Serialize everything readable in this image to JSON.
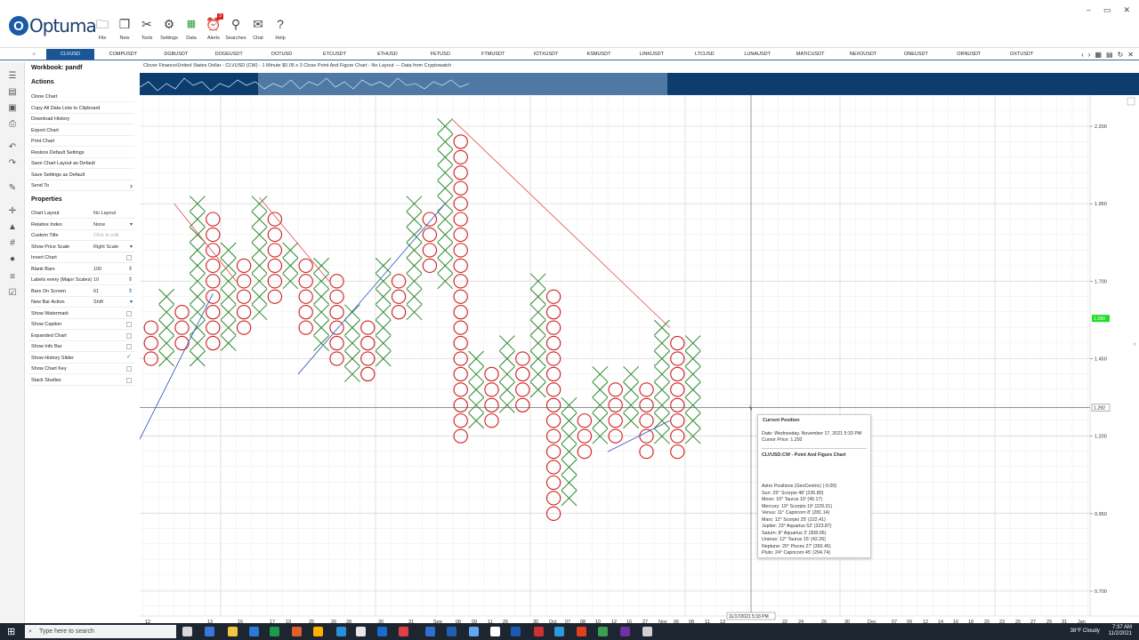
{
  "ribbon": {
    "logo_text": "Optuma",
    "buttons": [
      {
        "label": "File",
        "icon": "folder-icon"
      },
      {
        "label": "New",
        "icon": "new-document-icon"
      },
      {
        "label": "Tools",
        "icon": "tools-icon"
      },
      {
        "label": "Settings",
        "icon": "gear-icon"
      },
      {
        "label": "Data",
        "icon": "data-icon"
      },
      {
        "label": "Alerts",
        "icon": "alarm-clock-icon",
        "badge": "3"
      },
      {
        "label": "Searches",
        "icon": "search-icon"
      },
      {
        "label": "Chat",
        "icon": "chat-icon"
      },
      {
        "label": "Help",
        "icon": "help-icon"
      }
    ]
  },
  "tabs": [
    "CLVUSD",
    "COMPUSDT",
    "DGBUSDT",
    "DOGEUSDT",
    "DOTUSD",
    "ETCUSDT",
    "ETHUSD",
    "FETUSD",
    "FTMUSDT",
    "IOTXUSDT",
    "KSMUSDT",
    "LINKUSDT",
    "LTCUSD",
    "LUNAUSDT",
    "MATICUSDT",
    "NEXOUSDT",
    "ONEUSDT",
    "ORNUSDT",
    "OXTUSDT"
  ],
  "active_tab": "CLVUSD",
  "panel": {
    "workbook": "Workbook: pandf",
    "actions_heading": "Actions",
    "actions": [
      "Clone Chart",
      "Copy All Data Lists to Clipboard",
      "Download History",
      "Export Chart",
      "Print Chart",
      "Restore Default Settings",
      "Save Chart Layout as Default",
      "Save Settings as Default",
      "Send To"
    ],
    "properties_heading": "Properties",
    "properties": [
      {
        "label": "Chart Layout",
        "value": "No Layout",
        "kind": "text"
      },
      {
        "label": "Relative Index",
        "value": "None",
        "kind": "select"
      },
      {
        "label": "Custom Title",
        "value": "Click to edit",
        "kind": "muted"
      },
      {
        "label": "Show Price Scale",
        "value": "Right Scale",
        "kind": "select"
      },
      {
        "label": "Invert Chart",
        "value": "",
        "kind": "check",
        "checked": false
      },
      {
        "label": "Blank Bars",
        "value": "100",
        "kind": "spin"
      },
      {
        "label": "Labels every (Major Scales)",
        "value": "10",
        "kind": "spin"
      },
      {
        "label": "Bars On Screen",
        "value": "61",
        "kind": "spin"
      },
      {
        "label": "New Bar Action",
        "value": "Shift",
        "kind": "select"
      },
      {
        "label": "Show Watermark",
        "value": "",
        "kind": "check",
        "checked": false
      },
      {
        "label": "Show Caption",
        "value": "",
        "kind": "check",
        "checked": false
      },
      {
        "label": "Expanded Chart",
        "value": "",
        "kind": "check",
        "checked": false
      },
      {
        "label": "Show Info Bar",
        "value": "",
        "kind": "check",
        "checked": false
      },
      {
        "label": "Show History Slider",
        "value": "",
        "kind": "check",
        "checked": true
      },
      {
        "label": "Show Chart Key",
        "value": "",
        "kind": "check",
        "checked": false
      },
      {
        "label": "Stack Studies",
        "value": "",
        "kind": "check",
        "checked": false
      }
    ]
  },
  "chart_title": "Clover Finance/United States Dollar - CLVUSD (CW) - 1 Minute $0.05 x 3 Close Point And Figure Chart - No Layout --- Data from Cryptowatch",
  "chart_data": {
    "type": "point_and_figure",
    "box_size": 0.05,
    "reversal": 3,
    "y_ticks": [
      "2.200",
      "1.950",
      "1.700",
      "1.450",
      "1.200",
      "0.950",
      "0.700"
    ],
    "last_price": "1.580",
    "cursor_price": "1.292",
    "x_labels": [
      "12",
      "13",
      "16",
      "17",
      "19",
      "25",
      "26",
      "28",
      "30",
      "31",
      "Sep",
      "08",
      "09",
      "11",
      "26",
      "30",
      "Oct",
      "07",
      "08",
      "10",
      "12",
      "16",
      "27",
      "Nov",
      "06",
      "08",
      "11",
      "13",
      "22",
      "24",
      "26",
      "30",
      "Dec",
      "07",
      "09",
      "12",
      "14",
      "16",
      "18",
      "20",
      "23",
      "25",
      "27",
      "29",
      "31",
      "Jan"
    ],
    "cursor_date_label": "11/17/2021 5:33 PM",
    "columns": [
      {
        "type": "O",
        "top": 1.5,
        "bottom": 1.45
      },
      {
        "type": "X",
        "bottom": 1.45,
        "top": 1.6
      },
      {
        "type": "O",
        "top": 1.6,
        "bottom": 1.7
      },
      {
        "type": "X",
        "bottom": 1.55,
        "top": 1.9
      }
    ]
  },
  "tooltip": {
    "title": "Current Position",
    "date": "Date: Wednesday, November 17, 2021 5:33 PM",
    "cursor_price": "Cursor Price: 1.292",
    "chart_name": "CLVUSD:CW - Point And Figure Chart",
    "astro_heading": "Astro Positions (GeoCentric) (-5:00)",
    "astro": [
      "Sun: 25° Scorpio 48' (235.80)",
      "Moon: 10° Taurus 10' (40.17)",
      "Mercury: 19° Scorpio 19' (229.31)",
      "Venus: 11° Capricorn 8' (281.14)",
      "Mars: 12° Scorpio 25' (222.41)",
      "Jupiter: 23° Aquarius 52' (323.87)",
      "Saturn: 8° Aquarius 3' (308.06)",
      "Uranus: 12° Taurus 15' (42.26)",
      "Neptune: 20° Pisces 27' (350.45)",
      "Pluto: 24° Capricorn 45' (294.74)"
    ]
  },
  "taskbar": {
    "search_placeholder": "Type here to search",
    "weather": "38°F Cloudy",
    "time": "7:37 AM",
    "date": "11/2/2021"
  },
  "colors": {
    "x": "#2a8a2a",
    "o": "#d02020",
    "brand": "#1a5596",
    "trend_up": "#3050c0",
    "trend_down": "#e05050"
  }
}
